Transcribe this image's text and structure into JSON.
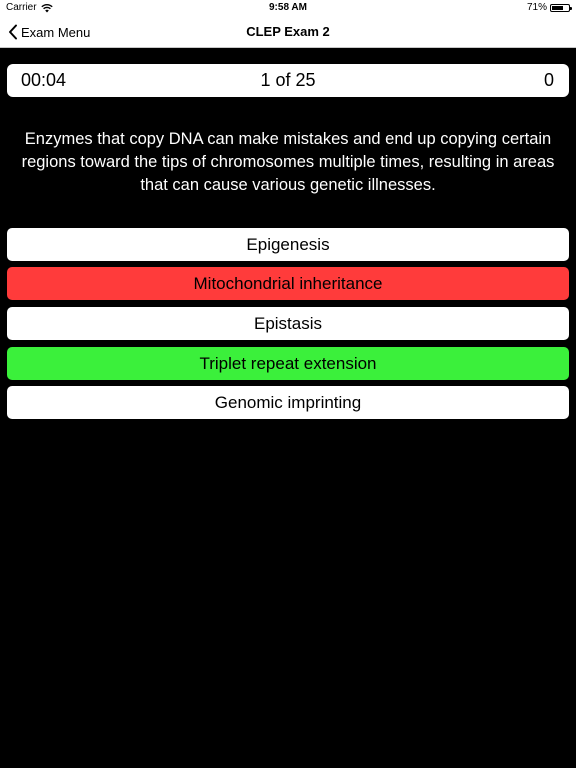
{
  "status_bar": {
    "carrier": "Carrier",
    "time": "9:58 AM",
    "battery": "71%",
    "battery_level": 0.71
  },
  "nav": {
    "back_label": "Exam Menu",
    "title": "CLEP Exam 2"
  },
  "score_bar": {
    "timer": "00:04",
    "progress": "1 of 25",
    "score": "0"
  },
  "question": "Enzymes that copy DNA can make mistakes and end up copying certain regions toward the tips of chromosomes multiple times, resulting in areas that can cause various genetic illnesses.",
  "answers": [
    {
      "label": "Epigenesis",
      "state": "default"
    },
    {
      "label": "Mitochondrial inheritance",
      "state": "wrong"
    },
    {
      "label": "Epistasis",
      "state": "default"
    },
    {
      "label": "Triplet repeat extension",
      "state": "correct"
    },
    {
      "label": "Genomic imprinting",
      "state": "default"
    }
  ],
  "colors": {
    "background": "#000000",
    "wrong": "#ff3b3b",
    "correct": "#3bf03b"
  }
}
